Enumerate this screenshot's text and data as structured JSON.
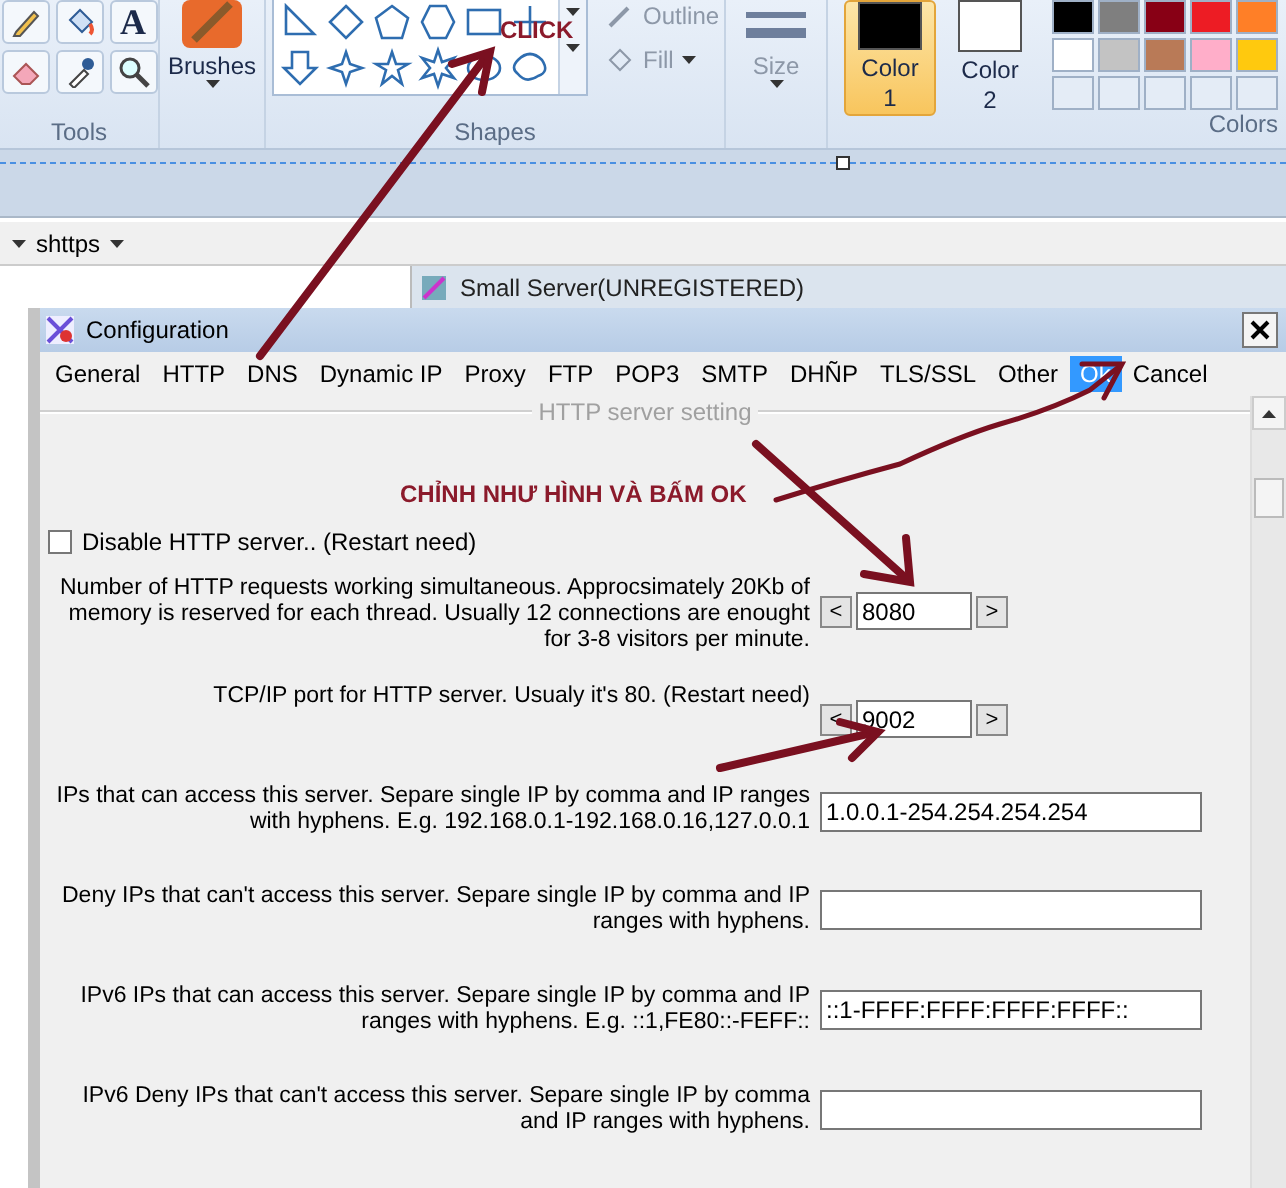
{
  "paint_ribbon": {
    "tools": {
      "label": "Tools",
      "text_tool_glyph": "A"
    },
    "brushes": {
      "label": "Brushes"
    },
    "shapes": {
      "label": "Shapes"
    },
    "outline": {
      "label": "Outline",
      "disabled": true
    },
    "fill": {
      "label": "Fill",
      "disabled": true
    },
    "size": {
      "label": "Size",
      "disabled": true
    },
    "colors": [
      {
        "label": "Color 1",
        "color": "#000000",
        "selected": true
      },
      {
        "label": "Color 2",
        "color": "#ffffff",
        "selected": false
      }
    ],
    "palette": {
      "label": "Colors",
      "swatches": [
        {
          "color": "#000000"
        },
        {
          "color": "#7f7f7f"
        },
        {
          "color": "#880015"
        },
        {
          "color": "#ed1c24"
        },
        {
          "color": "#ff7f27"
        },
        {
          "color": "#ffffff"
        },
        {
          "color": "#c3c3c3"
        },
        {
          "color": "#b97a57"
        },
        {
          "color": "#ffaec9"
        },
        {
          "color": "#ffc90e"
        }
      ]
    }
  },
  "toolbar": {
    "item": "shttps"
  },
  "background_window": {
    "title": "Small Server(UNREGISTERED)"
  },
  "dialog": {
    "title": "Configuration",
    "menu": [
      {
        "label": "General",
        "selected": false
      },
      {
        "label": "HTTP",
        "selected": false
      },
      {
        "label": "DNS",
        "selected": false
      },
      {
        "label": "Dynamic IP",
        "selected": false
      },
      {
        "label": "Proxy",
        "selected": false
      },
      {
        "label": "FTP",
        "selected": false
      },
      {
        "label": "POP3",
        "selected": false
      },
      {
        "label": "SMTP",
        "selected": false
      },
      {
        "label": "DHÑP",
        "selected": false
      },
      {
        "label": "TLS/SSL",
        "selected": false
      },
      {
        "label": "Other",
        "selected": false
      },
      {
        "label": "Ok",
        "selected": true
      },
      {
        "label": "Cancel",
        "selected": false
      }
    ],
    "group_title": "HTTP server setting",
    "disable_checkbox": {
      "label": "Disable HTTP server.. (Restart need)",
      "checked": false
    },
    "settings": [
      {
        "kind": "spinner",
        "label": "Number of HTTP requests working simultaneous. Approcsimately 20Kb of memory is reserved for each thread. Usually 12 connections are enought for 3-8 visitors per minute.",
        "value": "8080",
        "decrement": "<",
        "increment": ">"
      },
      {
        "kind": "spinner",
        "label": "TCP/IP port for HTTP server. Usualy it's 80. (Restart need)",
        "value": "9002",
        "decrement": "<",
        "increment": ">"
      },
      {
        "kind": "text",
        "label": "IPs that can access this server. Separe single IP by comma and IP ranges with hyphens. E.g. 192.168.0.1-192.168.0.16,127.0.0.1",
        "value": "1.0.0.1-254.254.254.254"
      },
      {
        "kind": "text",
        "label": "Deny IPs that can't access this server. Separe single IP by comma and IP ranges with hyphens."
      },
      {
        "kind": "text",
        "label": "IPv6 IPs that can access this server. Separe single IP by comma and IP ranges with hyphens. E.g. ::1,FE80::-FEFF::",
        "value": "::1-FFFF:FFFF:FFFF:FFFF::"
      },
      {
        "kind": "text",
        "label": "IPv6 Deny IPs that can't access this server. Separe single IP by comma and IP ranges with hyphens."
      }
    ]
  },
  "annotations": [
    {
      "kind": "label",
      "text": "CLICK"
    },
    {
      "kind": "label",
      "text": "CHỈNH NHƯ HÌNH VÀ BẤM OK"
    }
  ]
}
